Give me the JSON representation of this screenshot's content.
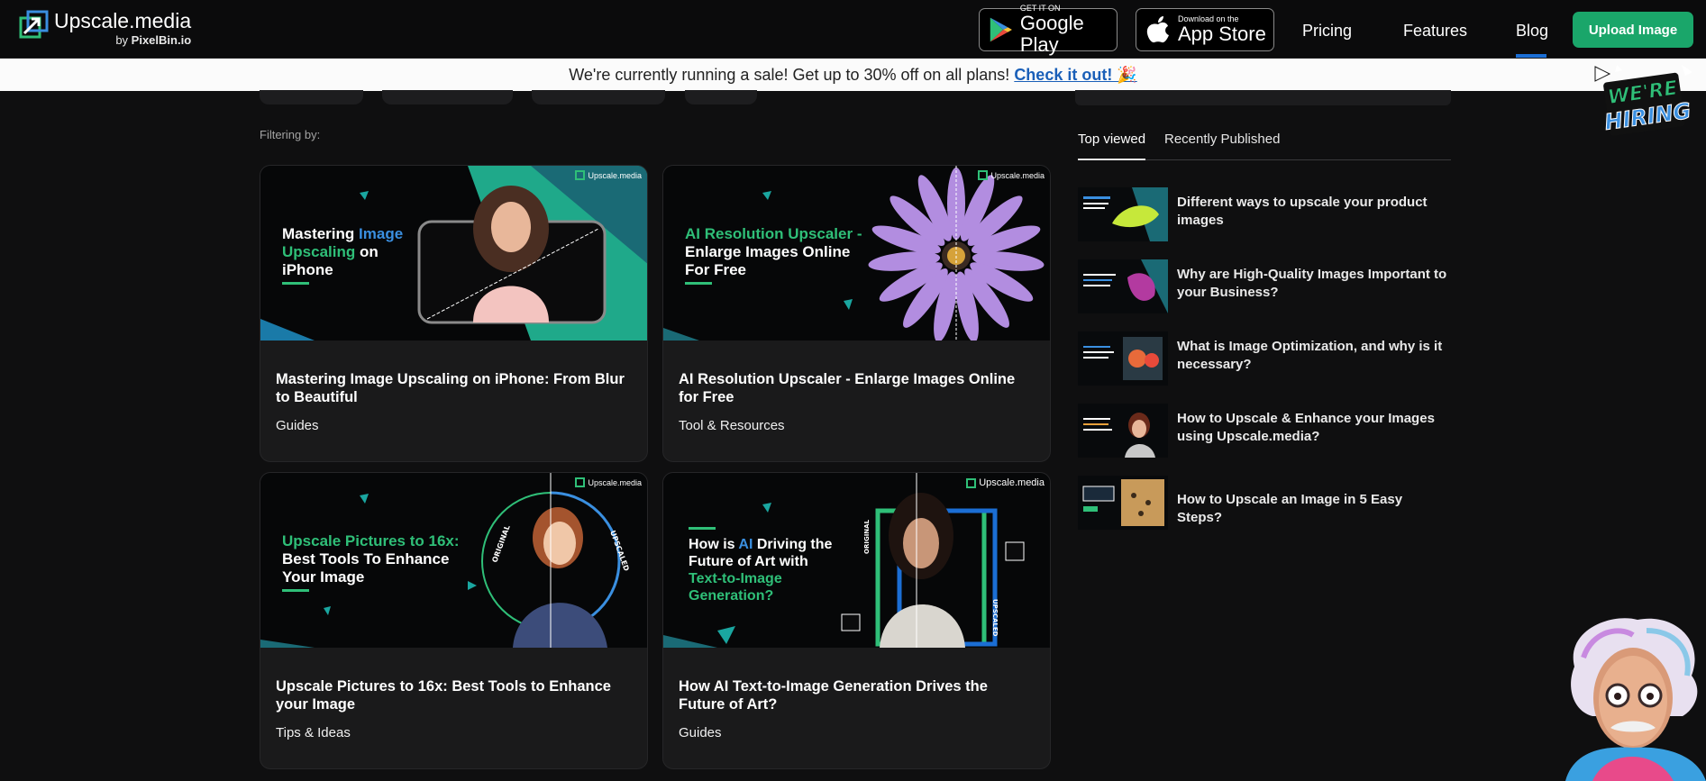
{
  "header": {
    "logo_title": "Upscale.media",
    "logo_sub_prefix": "by",
    "logo_sub_brand": "PixelBin.io",
    "google_play_small": "GET IT ON",
    "google_play_big": "Google Play",
    "app_store_small": "Download on the",
    "app_store_big": "App Store",
    "nav": {
      "pricing": "Pricing",
      "features": "Features",
      "blog": "Blog"
    },
    "upload_label": "Upload Image"
  },
  "sale": {
    "text": "We're currently running a sale! Get up to 30% off on all plans!",
    "link": "Check it out! 🎉"
  },
  "hiring": {
    "line1": "WE'RE",
    "line2": "HIRING"
  },
  "filter_label": "Filtering by:",
  "cards": [
    {
      "thumb_brand": "Upscale.media",
      "title": "Mastering Image Upscaling on iPhone: From Blur to Beautiful",
      "category": "Guides"
    },
    {
      "thumb_brand": "Upscale.media",
      "title": "AI Resolution Upscaler - Enlarge Images Online for Free",
      "category": "Tool & Resources"
    },
    {
      "thumb_brand": "Upscale.media",
      "title": "Upscale Pictures to 16x: Best Tools to Enhance your Image",
      "category": "Tips & Ideas"
    },
    {
      "thumb_brand": "Upscale.media",
      "title": "How AI Text-to-Image Generation Drives the Future of Art?",
      "category": "Guides"
    }
  ],
  "thumbs": {
    "t1": {
      "w1": "Mastering ",
      "w2": "Image",
      "w3": "Upscaling",
      "w4": " on",
      "w5": "iPhone"
    },
    "t2": {
      "w1": "AI Resolution Upscaler -",
      "w2": "Enlarge Images Online",
      "w3": "For Free"
    },
    "t3": {
      "w1": "Upscale Pictures to 16x:",
      "w2": "Best Tools To Enhance",
      "w3": "Your Image",
      "original": "ORIGINAL",
      "upscaled": "UPSCALED"
    },
    "t4": {
      "w1": "How is ",
      "w2": "AI",
      "w3": " Driving the",
      "w4": "Future of Art with",
      "w5": "Text-to-Image",
      "w6": "Generation?",
      "original": "ORIGINAL",
      "upscaled": "UPSCALED"
    }
  },
  "sidebar": {
    "tabs": [
      "Top viewed",
      "Recently Published"
    ],
    "popular": [
      "Different ways to upscale your product images",
      "Why are High-Quality Images Important to your Business?",
      "What is Image Optimization, and why is it necessary?",
      "How to Upscale & Enhance your Images using Upscale.media?",
      "How to Upscale an Image in 5 Easy Steps?"
    ]
  },
  "colors": {
    "accent_green": "#1aa66a",
    "blog_underline": "#1b6ed4",
    "link_blue": "#1a5fb8"
  }
}
